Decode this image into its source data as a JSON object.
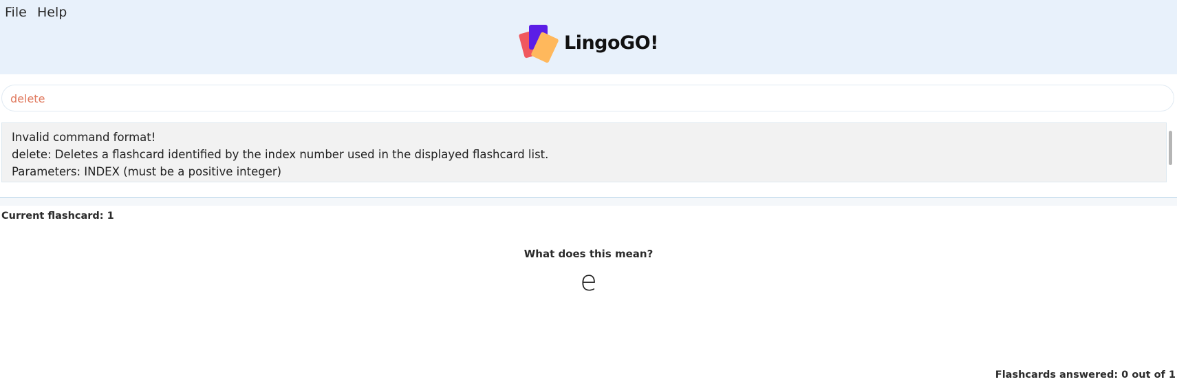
{
  "menu": {
    "items": [
      "File",
      "Help"
    ]
  },
  "logo": {
    "text": "LingoGO!",
    "colors": {
      "red": "#f0585e",
      "purple": "#5b1ee6",
      "orange": "#ffb85c"
    }
  },
  "command": {
    "value": "delete"
  },
  "result": {
    "lines": [
      "Invalid command format!",
      "delete: Deletes a flashcard identified by the index number used in the displayed flashcard list.",
      "Parameters: INDEX (must be a positive integer)"
    ]
  },
  "flashcard": {
    "current_label": "Current flashcard: 1",
    "question": "What does this mean?",
    "word": "e",
    "answered_label": "Flashcards answered: 0 out of 1"
  },
  "colors": {
    "header_bg": "#e8f1fb",
    "command_text": "#e07a5f",
    "result_bg": "#f2f2f2"
  }
}
